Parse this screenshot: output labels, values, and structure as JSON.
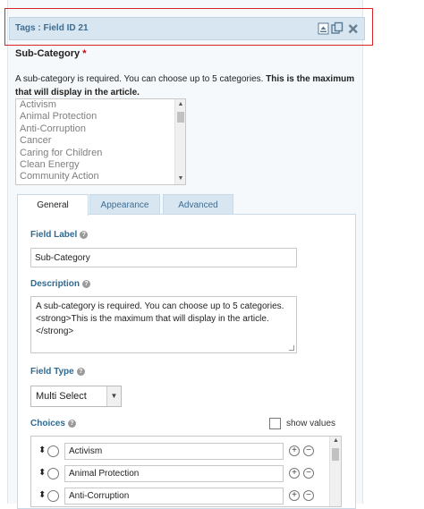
{
  "header": {
    "title": "Tags : Field ID 21"
  },
  "subcategory": {
    "title": "Sub-Category",
    "required_mark": "*",
    "description_plain": "A sub-category is required. You can choose up to 5 categories. ",
    "description_bold": "This is the maximum that will display in the article.",
    "options": [
      "Activism",
      "Animal Protection",
      "Anti-Corruption",
      "Cancer",
      "Caring for Children",
      "Clean Energy",
      "Community Action"
    ]
  },
  "tabs": [
    {
      "label": "General"
    },
    {
      "label": "Appearance"
    },
    {
      "label": "Advanced"
    }
  ],
  "general": {
    "field_label": {
      "label": "Field Label",
      "value": "Sub-Category"
    },
    "description": {
      "label": "Description",
      "value": "A sub-category is required. You can choose up to 5 categories. <strong>This is the maximum that will display in the article.</strong>"
    },
    "field_type": {
      "label": "Field Type",
      "selected": "Multi Select"
    },
    "choices": {
      "label": "Choices",
      "show_values_label": "show values",
      "show_values_checked": false,
      "items": [
        {
          "label": "Activism"
        },
        {
          "label": "Animal Protection"
        },
        {
          "label": "Anti-Corruption"
        }
      ]
    }
  },
  "colors": {
    "accent": "#2e6a93",
    "highlight_border": "#d7262b",
    "titlebar_bg": "#d7e6f1"
  }
}
